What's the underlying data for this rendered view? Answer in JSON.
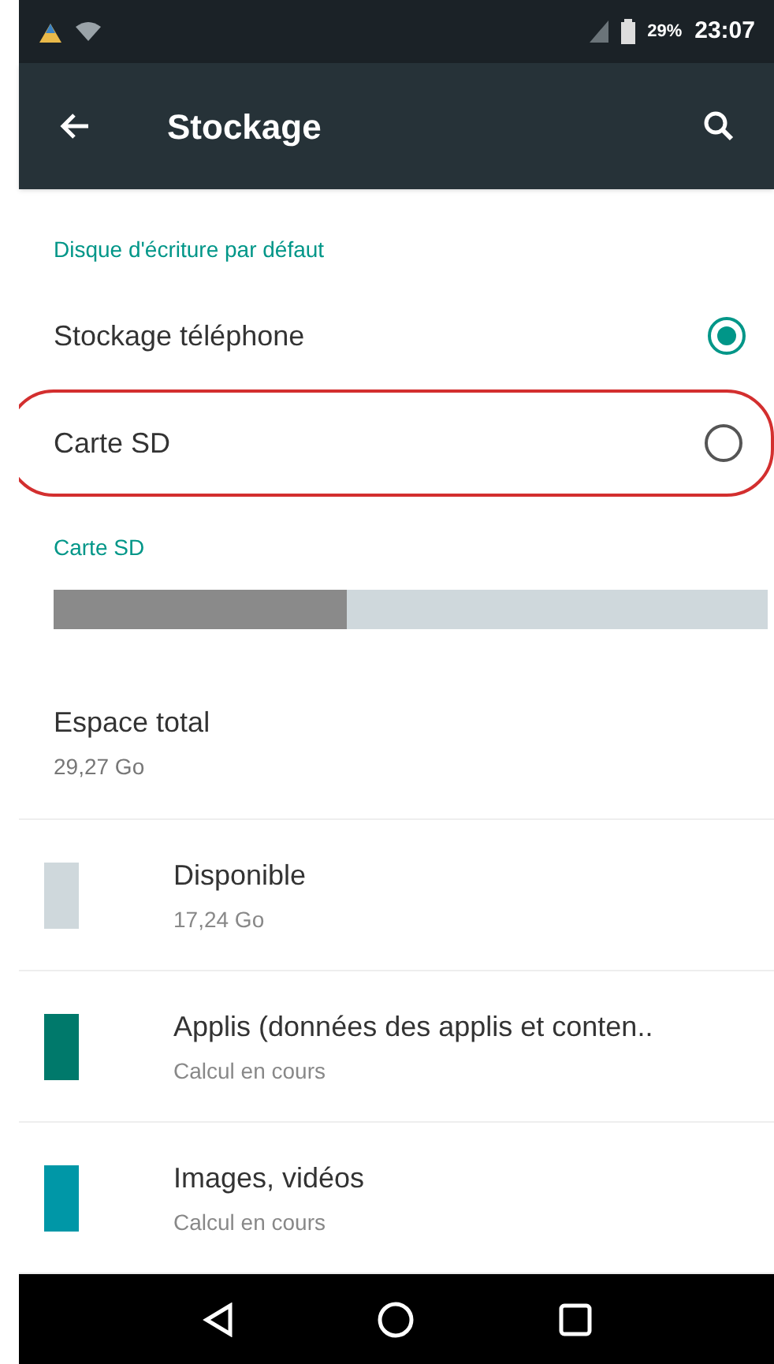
{
  "status_bar": {
    "battery": "29%",
    "time": "23:07"
  },
  "toolbar": {
    "title": "Stockage"
  },
  "default_disk": {
    "header": "Disque d'écriture par défaut",
    "options": [
      {
        "label": "Stockage téléphone",
        "selected": true,
        "highlighted": false
      },
      {
        "label": "Carte SD",
        "selected": false,
        "highlighted": true
      }
    ]
  },
  "sd_card": {
    "header": "Carte SD",
    "usage": {
      "level": 0.41
    },
    "total": {
      "title": "Espace total",
      "value": "29,27 Go"
    },
    "categories": [
      {
        "title": "Disponible",
        "subtitle": "17,24 Go",
        "color": "#cfd8dc"
      },
      {
        "title": "Applis (données des applis et conten..",
        "subtitle": "Calcul en cours",
        "color": "#00796b"
      },
      {
        "title": "Images, vidéos",
        "subtitle": "Calcul en cours",
        "color": "#0097a7"
      }
    ]
  }
}
